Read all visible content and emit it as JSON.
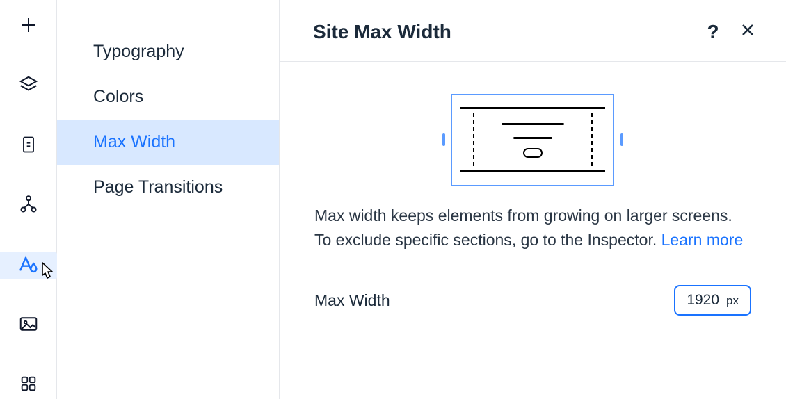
{
  "rail": {
    "items": [
      {
        "name": "add",
        "active": false
      },
      {
        "name": "layers",
        "active": false
      },
      {
        "name": "page",
        "active": false
      },
      {
        "name": "structure",
        "active": false
      },
      {
        "name": "styles",
        "active": true
      },
      {
        "name": "image",
        "active": false
      },
      {
        "name": "apps",
        "active": false
      }
    ]
  },
  "sidebar": {
    "items": [
      {
        "label": "Typography",
        "selected": false
      },
      {
        "label": "Colors",
        "selected": false
      },
      {
        "label": "Max Width",
        "selected": true
      },
      {
        "label": "Page Transitions",
        "selected": false
      }
    ]
  },
  "panel": {
    "title": "Site Max Width",
    "help_symbol": "?",
    "description": "Max width keeps elements from growing on larger screens. To exclude specific sections, go to the Inspector.",
    "learn_more": "Learn more",
    "field_label": "Max Width",
    "field_value": "1920",
    "field_unit": "px"
  }
}
